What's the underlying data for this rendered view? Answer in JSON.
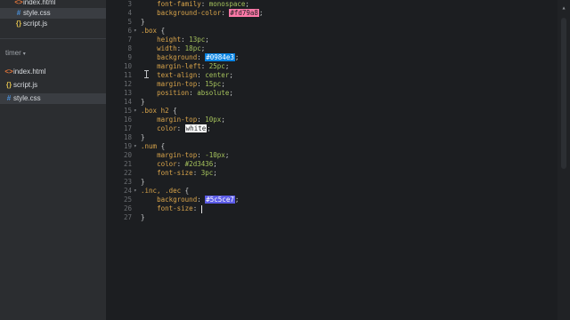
{
  "sidebar": {
    "top_files": [
      {
        "icon": "<>",
        "label": "index.html",
        "color": "#e2763b"
      },
      {
        "icon": "#",
        "label": "style.css",
        "color": "#4a90d9",
        "active": true
      },
      {
        "icon": "{}",
        "label": "script.js",
        "color": "#d6b84c"
      }
    ],
    "folder": "timer",
    "folder_files": [
      {
        "icon": "<>",
        "label": "index.html",
        "color": "#e2763b"
      },
      {
        "icon": "{}",
        "label": "script.js",
        "color": "#d6b84c"
      },
      {
        "icon": "#",
        "label": "style.css",
        "color": "#4a90d9",
        "active": true
      }
    ]
  },
  "editor": {
    "lines": [
      {
        "n": "3",
        "fold": "",
        "code": [
          {
            "t": "    "
          },
          {
            "t": "font-family",
            "c": "prop"
          },
          {
            "t": ": "
          },
          {
            "t": "monospace",
            "c": "val"
          },
          {
            "t": ";"
          }
        ]
      },
      {
        "n": "4",
        "fold": "",
        "code": [
          {
            "t": "    "
          },
          {
            "t": "background-color",
            "c": "prop"
          },
          {
            "t": ": "
          },
          {
            "t": "#fd79a8",
            "c": "swatch",
            "bg": "#fd79a8",
            "dark": true
          },
          {
            "t": ";"
          }
        ]
      },
      {
        "n": "5",
        "fold": "",
        "code": [
          {
            "t": "}"
          }
        ]
      },
      {
        "n": "6",
        "fold": "▾",
        "code": [
          {
            "t": ".box",
            "c": "sel"
          },
          {
            "t": " {"
          }
        ]
      },
      {
        "n": "7",
        "fold": "",
        "code": [
          {
            "t": "    "
          },
          {
            "t": "height",
            "c": "prop"
          },
          {
            "t": ": "
          },
          {
            "t": "13pc",
            "c": "val"
          },
          {
            "t": ";"
          }
        ]
      },
      {
        "n": "8",
        "fold": "",
        "code": [
          {
            "t": "    "
          },
          {
            "t": "width",
            "c": "prop"
          },
          {
            "t": ": "
          },
          {
            "t": "18pc",
            "c": "val"
          },
          {
            "t": ";"
          }
        ]
      },
      {
        "n": "9",
        "fold": "",
        "code": [
          {
            "t": "    "
          },
          {
            "t": "background",
            "c": "prop"
          },
          {
            "t": ": "
          },
          {
            "t": "#0984e3",
            "c": "swatch",
            "bg": "#0984e3"
          },
          {
            "t": ";"
          }
        ]
      },
      {
        "n": "10",
        "fold": "",
        "code": [
          {
            "t": "    "
          },
          {
            "t": "margin-left",
            "c": "prop"
          },
          {
            "t": ": "
          },
          {
            "t": "25pc",
            "c": "val"
          },
          {
            "t": ";"
          }
        ]
      },
      {
        "n": "11",
        "fold": "",
        "code": [
          {
            "t": "    "
          },
          {
            "t": "text-align",
            "c": "prop"
          },
          {
            "t": ": "
          },
          {
            "t": "center",
            "c": "val"
          },
          {
            "t": ";"
          }
        ]
      },
      {
        "n": "12",
        "fold": "",
        "code": [
          {
            "t": "    "
          },
          {
            "t": "margin-top",
            "c": "prop"
          },
          {
            "t": ": "
          },
          {
            "t": "15pc",
            "c": "val"
          },
          {
            "t": ";"
          }
        ]
      },
      {
        "n": "13",
        "fold": "",
        "code": [
          {
            "t": "    "
          },
          {
            "t": "position",
            "c": "prop"
          },
          {
            "t": ": "
          },
          {
            "t": "absolute",
            "c": "val"
          },
          {
            "t": ";"
          }
        ]
      },
      {
        "n": "14",
        "fold": "",
        "code": [
          {
            "t": "}"
          }
        ]
      },
      {
        "n": "15",
        "fold": "▾",
        "code": [
          {
            "t": ".box h2",
            "c": "sel"
          },
          {
            "t": " {"
          }
        ]
      },
      {
        "n": "16",
        "fold": "",
        "code": [
          {
            "t": "    "
          },
          {
            "t": "margin-top",
            "c": "prop"
          },
          {
            "t": ": "
          },
          {
            "t": "10px",
            "c": "val"
          },
          {
            "t": ";"
          }
        ]
      },
      {
        "n": "17",
        "fold": "",
        "code": [
          {
            "t": "    "
          },
          {
            "t": "color",
            "c": "prop"
          },
          {
            "t": ": "
          },
          {
            "t": "white",
            "c": "swatch",
            "bg": "#ffffff",
            "dark": true
          },
          {
            "t": ";"
          }
        ]
      },
      {
        "n": "18",
        "fold": "",
        "code": [
          {
            "t": "}"
          }
        ]
      },
      {
        "n": "19",
        "fold": "▾",
        "code": [
          {
            "t": ".num",
            "c": "sel"
          },
          {
            "t": " {"
          }
        ]
      },
      {
        "n": "20",
        "fold": "",
        "code": [
          {
            "t": "    "
          },
          {
            "t": "margin-top",
            "c": "prop"
          },
          {
            "t": ": "
          },
          {
            "t": "-10px",
            "c": "val"
          },
          {
            "t": ";"
          }
        ]
      },
      {
        "n": "21",
        "fold": "",
        "code": [
          {
            "t": "    "
          },
          {
            "t": "color",
            "c": "prop"
          },
          {
            "t": ": "
          },
          {
            "t": "#2d3436",
            "c": "val"
          },
          {
            "t": ";"
          }
        ]
      },
      {
        "n": "22",
        "fold": "",
        "code": [
          {
            "t": "    "
          },
          {
            "t": "font-size",
            "c": "prop"
          },
          {
            "t": ": "
          },
          {
            "t": "3pc",
            "c": "val"
          },
          {
            "t": ";"
          }
        ]
      },
      {
        "n": "23",
        "fold": "",
        "code": [
          {
            "t": "}"
          }
        ]
      },
      {
        "n": "24",
        "fold": "▾",
        "code": [
          {
            "t": ".inc, .dec",
            "c": "sel"
          },
          {
            "t": " {"
          }
        ]
      },
      {
        "n": "25",
        "fold": "",
        "code": [
          {
            "t": "    "
          },
          {
            "t": "background",
            "c": "prop"
          },
          {
            "t": ": "
          },
          {
            "t": "#5c5ce7",
            "c": "swatch",
            "bg": "#5c5ce7"
          },
          {
            "t": ";"
          }
        ]
      },
      {
        "n": "26",
        "fold": "",
        "cursor": true,
        "code": [
          {
            "t": "    "
          },
          {
            "t": "font-size",
            "c": "prop"
          },
          {
            "t": ": "
          }
        ]
      },
      {
        "n": "27",
        "fold": "",
        "code": [
          {
            "t": "}"
          }
        ]
      }
    ]
  },
  "colors": {
    "selector": "#d7a34a",
    "property": "#d7a34a",
    "value": "#a5c25c"
  }
}
